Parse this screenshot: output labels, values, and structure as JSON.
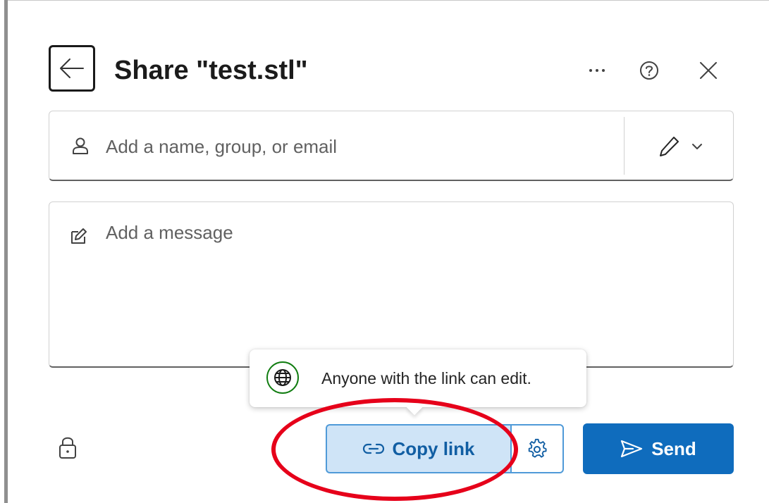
{
  "dialog": {
    "title": "Share \"test.stl\""
  },
  "recipients": {
    "placeholder": "Add a name, group, or email",
    "value": ""
  },
  "message": {
    "placeholder": "Add a message",
    "value": ""
  },
  "tooltip": {
    "text": "Anyone with the link can edit."
  },
  "footer": {
    "copy_link_label": "Copy link",
    "send_label": "Send"
  },
  "icons": {
    "back": "back-arrow-icon",
    "more": "more-options-icon",
    "help": "help-icon",
    "close": "close-icon",
    "person": "person-icon",
    "edit": "pencil-icon",
    "dropdown": "chevron-down-icon",
    "message": "compose-icon",
    "globe": "globe-icon",
    "lock": "lock-icon",
    "link": "link-icon",
    "settings": "gear-icon",
    "send": "send-icon"
  },
  "colors": {
    "accent": "#0f6cbd",
    "copy_link_bg": "#cfe4f7",
    "globe": "#107c10",
    "annotation": "#e6001a"
  }
}
